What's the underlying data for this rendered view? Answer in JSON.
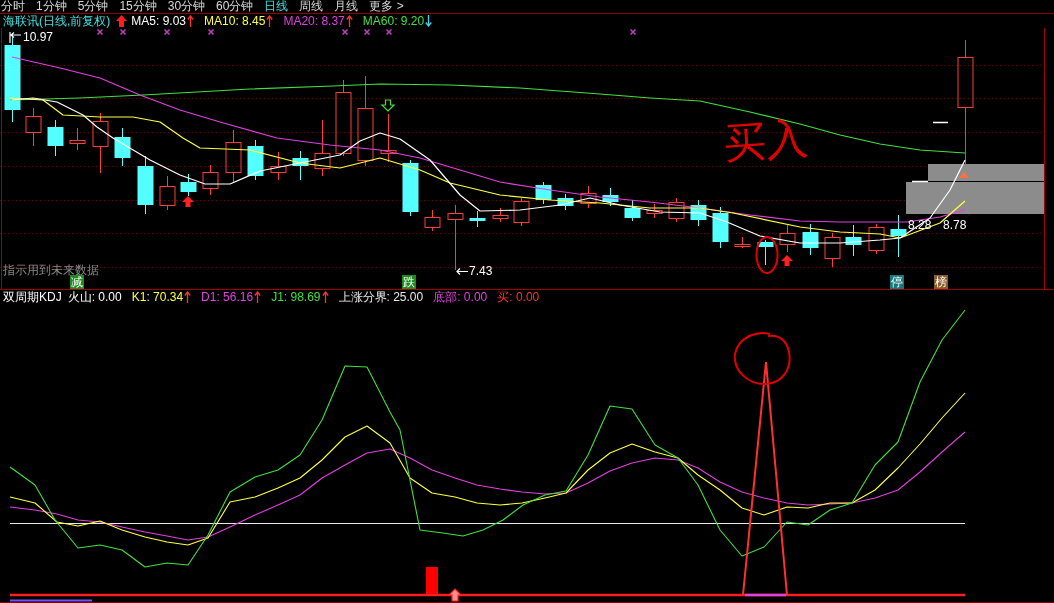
{
  "period_tabs": [
    {
      "label": "分时",
      "selected": false
    },
    {
      "label": "1分钟",
      "selected": false
    },
    {
      "label": "5分钟",
      "selected": false
    },
    {
      "label": "15分钟",
      "selected": false
    },
    {
      "label": "30分钟",
      "selected": false
    },
    {
      "label": "60分钟",
      "selected": false
    },
    {
      "label": "日线",
      "selected": true
    },
    {
      "label": "周线",
      "selected": false
    },
    {
      "label": "月线",
      "selected": false
    },
    {
      "label": "更多 >",
      "selected": false
    }
  ],
  "price_panel": {
    "title": "海联讯(日线,前复权)",
    "signal_arrow": true,
    "indicators": [
      {
        "label": "MA5: 9.03",
        "color": "#ffffff",
        "rising": true
      },
      {
        "label": "MA10: 8.45",
        "color": "#ffff40",
        "rising": true
      },
      {
        "label": "MA20: 8.37",
        "color": "#e040e0",
        "rising": true
      },
      {
        "label": "MA60: 9.20",
        "color": "#40e040",
        "rising": false
      }
    ],
    "high_label": "10.97",
    "low_label": "7.43",
    "price_labels": [
      "8.28",
      "8.78"
    ],
    "notice": "指示用到未来数据",
    "tags": [
      {
        "label": "减",
        "color": "#1f8a1f"
      },
      {
        "label": "跌",
        "color": "#1f8a1f"
      },
      {
        "label": "停",
        "color": "#16787a"
      },
      {
        "label": "榜",
        "color": "#8a5a2a"
      }
    ],
    "handwritten_note": "买入"
  },
  "kdj_panel": {
    "title": "双周期KDJ",
    "indicators": [
      {
        "label": "火山: 0.00",
        "color": "#ffffff"
      },
      {
        "label": "K1: 70.34",
        "color": "#ffff40",
        "rising": true
      },
      {
        "label": "D1: 56.16",
        "color": "#e040e0",
        "rising": true
      },
      {
        "label": "J1: 98.69",
        "color": "#40e040",
        "rising": true
      },
      {
        "label": "上涨分界: 25.00",
        "color": "#e8e8e8"
      },
      {
        "label": "底部: 0.00",
        "color": "#e040e0"
      },
      {
        "label": "买: 0.00",
        "color": "#ff3030"
      }
    ]
  }
}
